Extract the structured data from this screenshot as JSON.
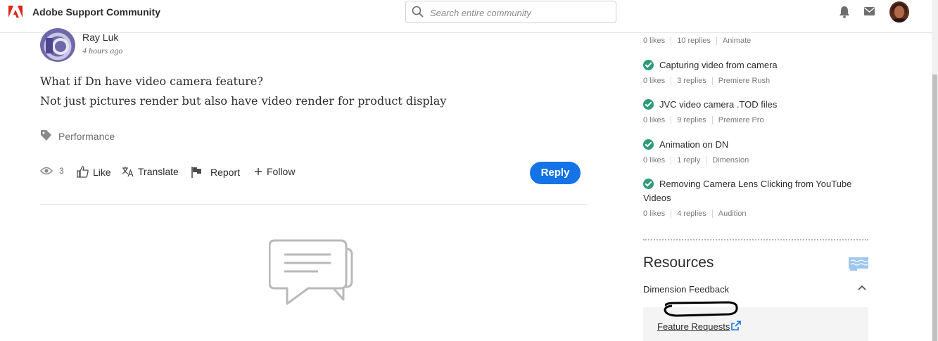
{
  "header": {
    "brand": "Adobe Support Community",
    "search_placeholder": "Search entire community"
  },
  "post": {
    "author": "Ray Luk",
    "time": "4 hours ago",
    "lines": [
      "What if Dn have video camera feature?",
      "Not just pictures render but also have video render for product display"
    ],
    "tag": "Performance",
    "views": "3",
    "actions": {
      "like": "Like",
      "translate": "Translate",
      "report": "Report",
      "follow": "Follow"
    },
    "reply_label": "Reply"
  },
  "sidebar": {
    "top_meta": {
      "likes": "0 likes",
      "replies": "10 replies",
      "board": "Animate"
    },
    "threads": [
      {
        "title": "Capturing video from camera",
        "likes": "0 likes",
        "replies": "3 replies",
        "board": "Premiere Rush"
      },
      {
        "title": "JVC video camera .TOD files",
        "likes": "0 likes",
        "replies": "9 replies",
        "board": "Premiere Pro"
      },
      {
        "title": "Animation on DN",
        "likes": "0 likes",
        "replies": "1 reply",
        "board": "Dimension"
      },
      {
        "title": "Removing Camera Lens Clicking from YouTube Videos",
        "likes": "0 likes",
        "replies": "4 replies",
        "board": "Audition"
      }
    ],
    "resources_title": "Resources",
    "section_label": "Dimension Feedback",
    "link_label": "Feature Requests"
  },
  "colors": {
    "accent": "#1473e6",
    "brand_red": "#e1251b",
    "solved_green": "#2d9d78"
  }
}
